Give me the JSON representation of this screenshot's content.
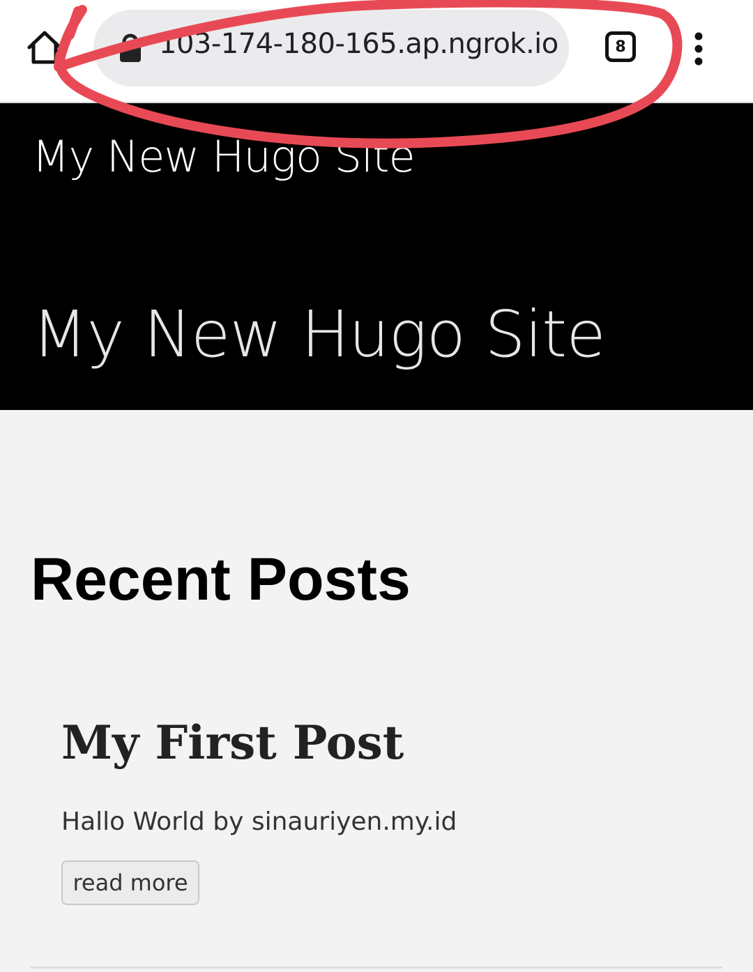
{
  "browser": {
    "url": "103-174-180-165.ap.ngrok.io",
    "tab_count": "8",
    "icons": {
      "home": "home-icon",
      "lock": "lock-icon",
      "tabs": "tab-switcher-icon",
      "menu": "more-vert-icon"
    }
  },
  "site": {
    "brand": "My New Hugo Site",
    "title": "My New Hugo Site"
  },
  "content": {
    "heading": "Recent Posts",
    "posts": [
      {
        "title": "My First Post",
        "summary": "Hallo World by sinauriyen.my.id",
        "read_more": "read more"
      }
    ]
  },
  "colors": {
    "header_bg": "#000000",
    "page_bg": "#f3f3f3",
    "annotation": "#e84a55"
  }
}
